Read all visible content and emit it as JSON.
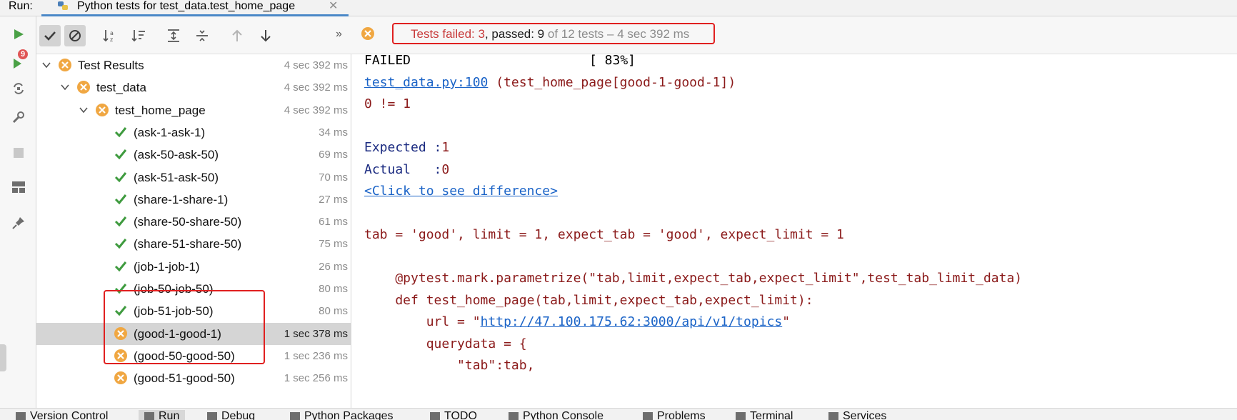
{
  "run_header": {
    "label": "Run:",
    "tab_title": "Python tests for test_data.test_home_page"
  },
  "status": {
    "failed_text": "Tests failed: 3",
    "sep": ", ",
    "passed_text": "passed: 9",
    "total_text": " of 12 tests – 4 sec 392 ms"
  },
  "toolbar": {
    "more": "»"
  },
  "left_strip": {
    "rerun_badge": "9"
  },
  "tree": [
    {
      "name": "Test Results",
      "time": "4 sec 392 ms",
      "level": 0,
      "status": "fail",
      "chevron": true
    },
    {
      "name": "test_data",
      "time": "4 sec 392 ms",
      "level": 1,
      "status": "fail",
      "chevron": true
    },
    {
      "name": "test_home_page",
      "time": "4 sec 392 ms",
      "level": 2,
      "status": "fail",
      "chevron": true
    },
    {
      "name": "(ask-1-ask-1)",
      "time": "34 ms",
      "level": 3,
      "status": "pass"
    },
    {
      "name": "(ask-50-ask-50)",
      "time": "69 ms",
      "level": 3,
      "status": "pass"
    },
    {
      "name": "(ask-51-ask-50)",
      "time": "70 ms",
      "level": 3,
      "status": "pass"
    },
    {
      "name": "(share-1-share-1)",
      "time": "27 ms",
      "level": 3,
      "status": "pass"
    },
    {
      "name": "(share-50-share-50)",
      "time": "61 ms",
      "level": 3,
      "status": "pass"
    },
    {
      "name": "(share-51-share-50)",
      "time": "75 ms",
      "level": 3,
      "status": "pass"
    },
    {
      "name": "(job-1-job-1)",
      "time": "26 ms",
      "level": 3,
      "status": "pass"
    },
    {
      "name": "(job-50-job-50)",
      "time": "80 ms",
      "level": 3,
      "status": "pass"
    },
    {
      "name": "(job-51-job-50)",
      "time": "80 ms",
      "level": 3,
      "status": "pass"
    },
    {
      "name": "(good-1-good-1)",
      "time": "1 sec 378 ms",
      "level": 3,
      "status": "fail",
      "selected": true
    },
    {
      "name": "(good-50-good-50)",
      "time": "1 sec 236 ms",
      "level": 3,
      "status": "fail"
    },
    {
      "name": "(good-51-good-50)",
      "time": "1 sec 256 ms",
      "level": 3,
      "status": "fail"
    }
  ],
  "console": {
    "failed_word": "FAILED",
    "progress": "[ 83%]",
    "location_link": "test_data.py:100",
    "location_rest": " (test_home_page[good-1-good-1])",
    "assertion": "0 != 1",
    "expected_label": "Expected :",
    "expected_value": "1",
    "actual_label": "Actual   :",
    "actual_value": "0",
    "diff_link": "<Click to see difference>",
    "params_line": "tab = 'good', limit = 1, expect_tab = 'good', expect_limit = 1",
    "code_decorator": "    @pytest.mark.parametrize(\"tab,limit,expect_tab,expect_limit\",test_tab_limit_data)",
    "code_def": "    def test_home_page(tab,limit,expect_tab,expect_limit):",
    "code_url_prefix": "        url = \"",
    "code_url_link": "http://47.100.175.62:3000/api/v1/topics",
    "code_url_suffix": "\"",
    "code_query": "        querydata = {",
    "code_tab": "            \"tab\":tab,"
  },
  "bottom_tabs": [
    {
      "label": "Version Control",
      "name": "version-control"
    },
    {
      "label": "Run",
      "name": "run",
      "active": true
    },
    {
      "label": "Debug",
      "name": "debug"
    },
    {
      "label": "Python Packages",
      "name": "python-packages"
    },
    {
      "label": "TODO",
      "name": "todo"
    },
    {
      "label": "Python Console",
      "name": "python-console"
    },
    {
      "label": "Problems",
      "name": "problems"
    },
    {
      "label": "Terminal",
      "name": "terminal"
    },
    {
      "label": "Services",
      "name": "services"
    }
  ],
  "colors": {
    "pass_green": "#3f9b3f",
    "fail_orange": "#f0a742",
    "highlight_red": "#e02020",
    "run_green": "#4aa146"
  }
}
